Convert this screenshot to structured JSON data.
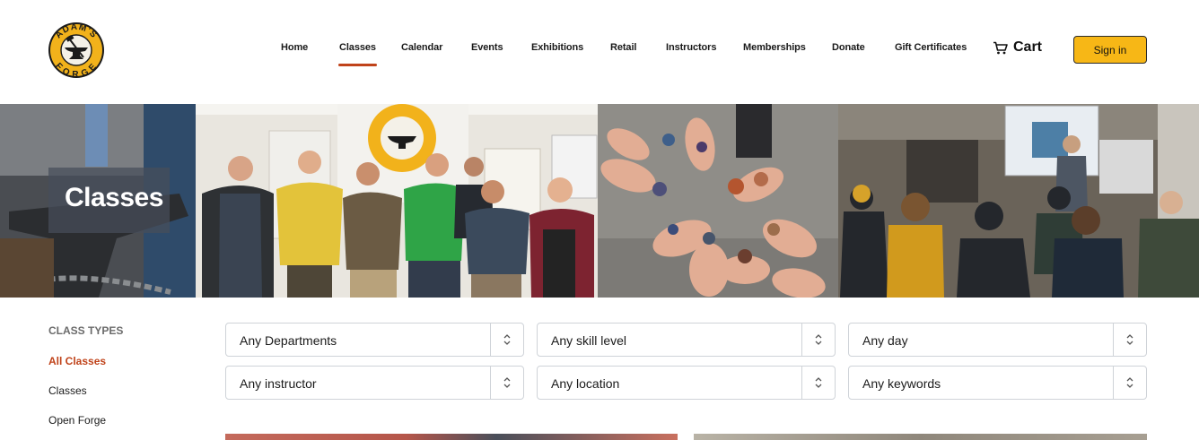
{
  "brand": {
    "logo_top_text": "ADAM'S",
    "logo_bottom_text": "FORGE",
    "colors": {
      "logo_yellow": "#f2b21b",
      "accent": "#c0431a",
      "signin_bg": "#f7b716"
    }
  },
  "nav": {
    "items": [
      {
        "label": "Home",
        "active": false
      },
      {
        "label": "Classes",
        "active": true
      },
      {
        "label": "Calendar",
        "active": false
      },
      {
        "label": "Events",
        "active": false
      },
      {
        "label": "Exhibitions",
        "active": false
      },
      {
        "label": "Retail",
        "active": false
      },
      {
        "label": "Instructors",
        "active": false
      },
      {
        "label": "Memberships",
        "active": false
      },
      {
        "label": "Donate",
        "active": false
      },
      {
        "label": "Gift Certificates",
        "active": false
      }
    ],
    "cart_icon": "cart-icon",
    "cart_label": "Cart",
    "signin_label": "Sign in"
  },
  "hero": {
    "title": "Classes",
    "panels": [
      "anvil-photo",
      "group-photo",
      "hands-jewelry-photo",
      "classroom-photo"
    ]
  },
  "sidebar": {
    "heading": "CLASS TYPES",
    "items": [
      {
        "label": "All Classes",
        "active": true
      },
      {
        "label": "Classes",
        "active": false
      },
      {
        "label": "Open Forge",
        "active": false
      }
    ]
  },
  "filters": {
    "department": "Any Departments",
    "skill_level": "Any skill level",
    "day": "Any day",
    "instructor": "Any instructor",
    "location": "Any location",
    "keywords": "Any keywords",
    "arrow_icon": "select-arrows-icon"
  }
}
